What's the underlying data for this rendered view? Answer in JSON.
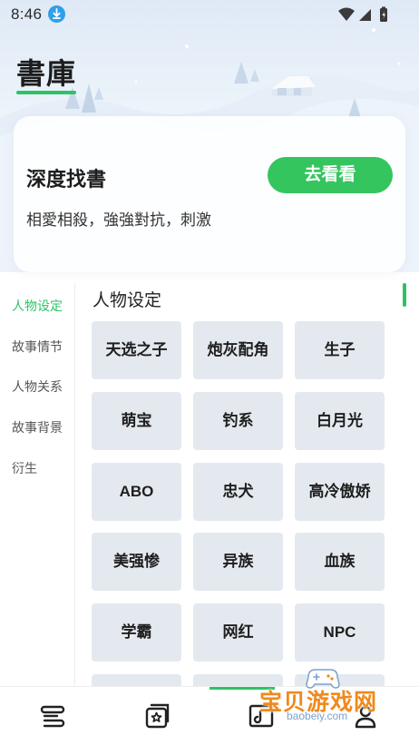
{
  "status_bar": {
    "time": "8:46"
  },
  "header": {
    "title": "書庫"
  },
  "promo": {
    "title": "深度找書",
    "subtitle": "相愛相殺，強強對抗，刺激",
    "button_label": "去看看"
  },
  "sidebar": {
    "items": [
      {
        "label": "人物设定",
        "active": true
      },
      {
        "label": "故事情节",
        "active": false
      },
      {
        "label": "人物关系",
        "active": false
      },
      {
        "label": "故事背景",
        "active": false
      },
      {
        "label": "衍生",
        "active": false
      }
    ]
  },
  "main": {
    "section_title": "人物设定",
    "tags": [
      "天选之子",
      "炮灰配角",
      "生子",
      "萌宝",
      "钓系",
      "白月光",
      "ABO",
      "忠犬",
      "高冷傲娇",
      "美强惨",
      "异族",
      "血族",
      "学霸",
      "网红",
      "NPC"
    ]
  },
  "tab_bar": {
    "icons": [
      "bookshelf-icon",
      "discover-icon",
      "library-icon",
      "profile-icon"
    ],
    "active_index": 2
  },
  "watermark": {
    "main": "宝贝游戏网",
    "sub": "baobeiy.com"
  },
  "colors": {
    "accent": "#2cc365",
    "button": "#34c55f",
    "tag_bg": "#e4e9ef"
  }
}
